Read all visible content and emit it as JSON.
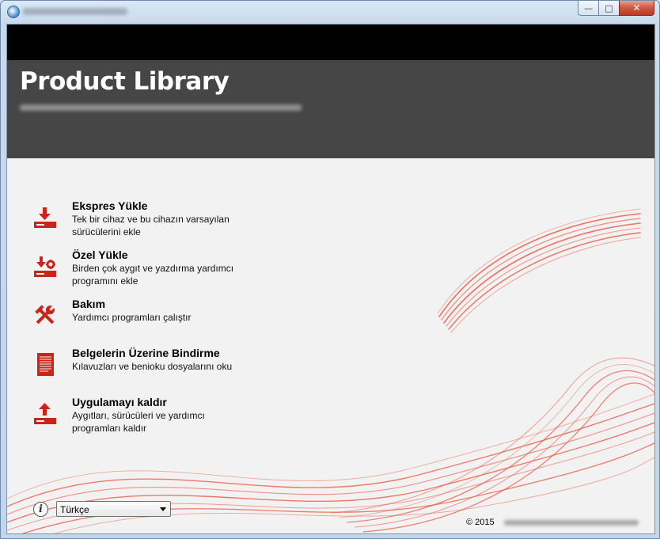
{
  "window": {
    "app_icon": "globe-icon",
    "buttons": {
      "minimize": "—",
      "maximize": "□",
      "close": "✕"
    }
  },
  "banner": {
    "title": "Product Library"
  },
  "menu": {
    "items": [
      {
        "icon": "download-icon",
        "title": "Ekspres Yükle",
        "description": "Tek bir cihaz ve bu cihazın varsayılan sürücülerini ekle"
      },
      {
        "icon": "custom-install-icon",
        "title": "Özel Yükle",
        "description": "Birden çok aygıt ve yazdırma yardımcı programını ekle"
      },
      {
        "icon": "tools-icon",
        "title": "Bakım",
        "description": "Yardımcı programları çalıştır"
      },
      {
        "icon": "document-icon",
        "title": "Belgelerin Üzerine Bindirme",
        "description": "Kılavuzları ve benioku dosyalarını oku"
      },
      {
        "icon": "uninstall-icon",
        "title": "Uygulamayı kaldır",
        "description": "Aygıtları, sürücüleri ve yardımcı programları kaldır"
      }
    ]
  },
  "footer": {
    "language_selected": "Türkçe",
    "copyright": "© 2015"
  },
  "colors": {
    "accent": "#c8261a",
    "banner": "#464646",
    "header_bar": "#000000",
    "background": "#f2f2f2"
  }
}
